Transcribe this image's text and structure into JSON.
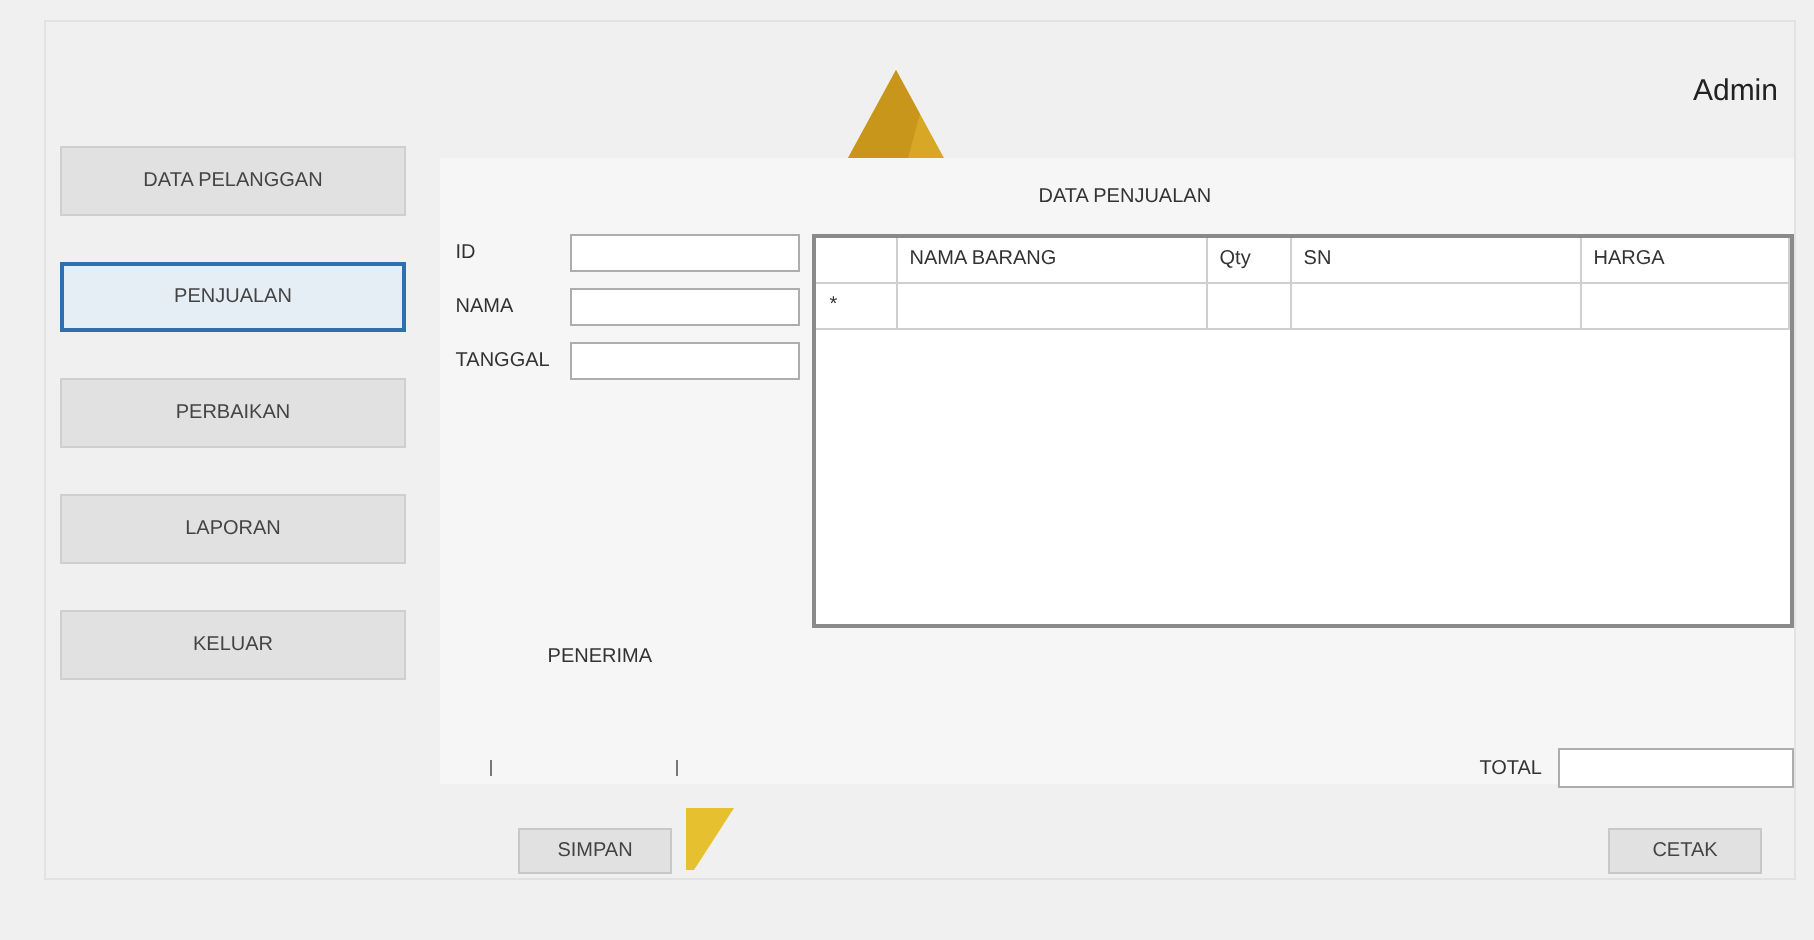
{
  "header": {
    "user": "Admin"
  },
  "nav": [
    {
      "label": "DATA PELANGGAN",
      "selected": false
    },
    {
      "label": "PENJUALAN",
      "selected": true
    },
    {
      "label": "PERBAIKAN",
      "selected": false
    },
    {
      "label": "LAPORAN",
      "selected": false
    },
    {
      "label": "KELUAR",
      "selected": false
    }
  ],
  "panel": {
    "title": "DATA PENJUALAN",
    "fields": [
      {
        "label": "ID"
      },
      {
        "label": "NAMA"
      },
      {
        "label": "TANGGAL"
      }
    ],
    "table": {
      "columns": [
        "NAMA BARANG",
        "Qty",
        "SN",
        "HARGA"
      ],
      "new_row_marker": "*"
    },
    "receiver_label": "PENERIMA",
    "total_label": "TOTAL"
  },
  "buttons": [
    "SIMPAN",
    "CETAK"
  ]
}
